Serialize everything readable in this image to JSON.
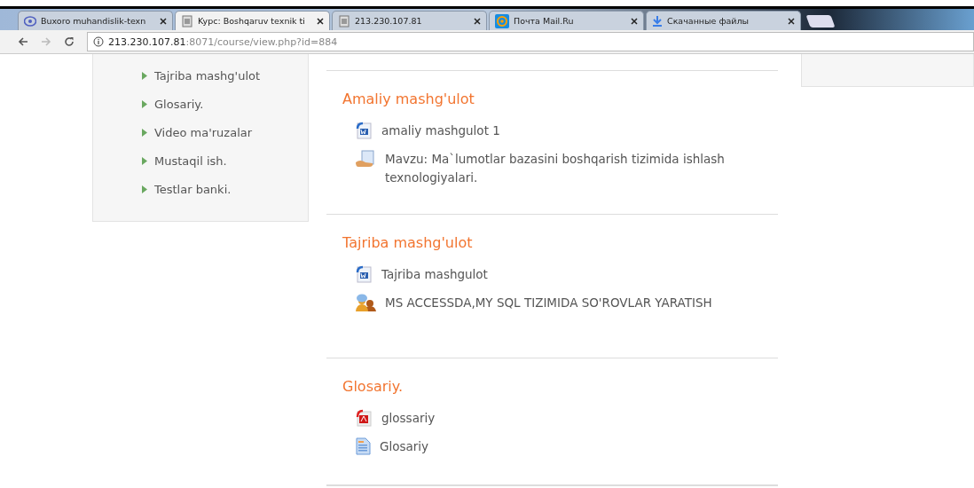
{
  "browser": {
    "tabs": [
      {
        "title": "Buxoro muhandislik-texn",
        "kind": "logo",
        "selected": false
      },
      {
        "title": "Kypc: Boshqaruv texnik ti",
        "kind": "page",
        "selected": true
      },
      {
        "title": "213.230.107.81",
        "kind": "page",
        "selected": false
      },
      {
        "title": "Почта Mail.Ru",
        "kind": "mail",
        "selected": false
      },
      {
        "title": "Скачанные файлы",
        "kind": "download",
        "selected": false
      }
    ],
    "address": {
      "host": "213.230.107.81",
      "path": ":8071/course/view.php?id=884"
    }
  },
  "sidebar": {
    "items": [
      {
        "label": "Tajriba mashg'ulot"
      },
      {
        "label": "Glosariy."
      },
      {
        "label": "Video ma'ruzalar"
      },
      {
        "label": "Mustaqil ish."
      },
      {
        "label": "Testlar banki."
      }
    ]
  },
  "sections": [
    {
      "title": "Amaliy mashg'ulot",
      "activities": [
        {
          "kind": "word",
          "label": "amaliy mashgulot 1"
        },
        {
          "kind": "resource",
          "label": "Mavzu: Ma`lumotlar bazasini boshqarish tizimida ishlash texnologiyalari."
        }
      ]
    },
    {
      "title": "Tajriba mashg'ulot",
      "activities": [
        {
          "kind": "word",
          "label": "Tajriba mashgulot"
        },
        {
          "kind": "chat",
          "label": "MS ACCESSDA,MY SQL TIZIMIDA SO'ROVLAR YARATISH"
        }
      ]
    },
    {
      "title": "Glosariy.",
      "activities": [
        {
          "kind": "pdf",
          "label": "glossariy"
        },
        {
          "kind": "page",
          "label": "Glosariy"
        }
      ]
    }
  ]
}
